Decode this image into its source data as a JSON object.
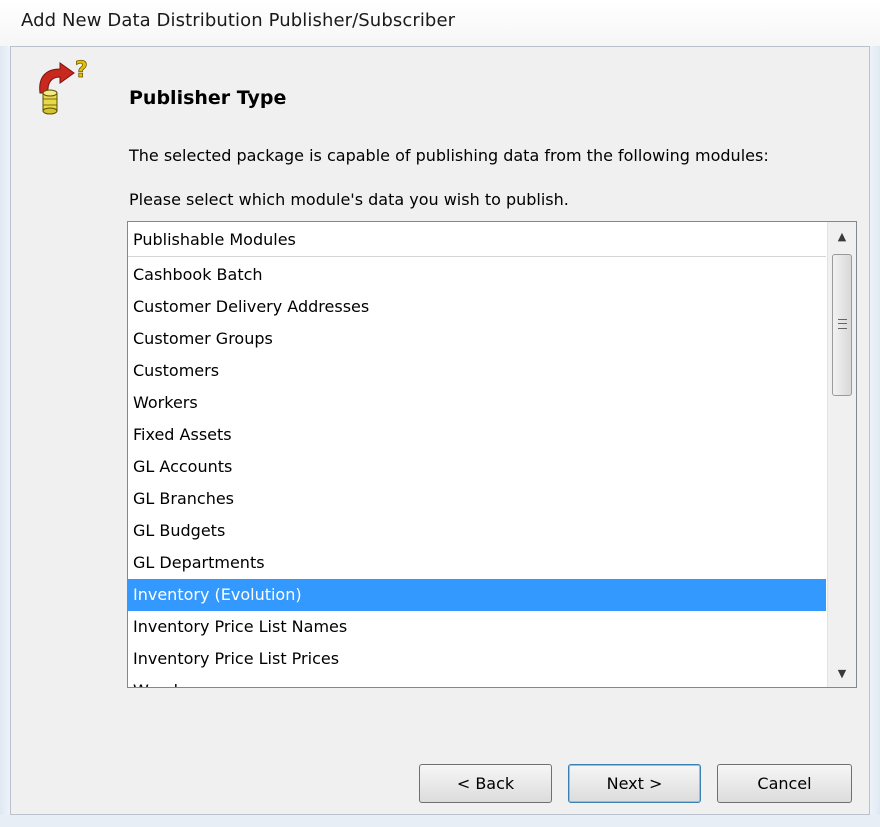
{
  "window": {
    "title": "Add New Data Distribution Publisher/Subscriber"
  },
  "page": {
    "heading": "Publisher Type",
    "description": "The selected package is capable of publishing data from the following modules:",
    "instruction": "Please select which module's data you wish to publish."
  },
  "list": {
    "column_header": "Publishable Modules",
    "selected_item": "Inventory (Evolution)",
    "items": [
      "Cashbook Batch",
      "Customer Delivery Addresses",
      "Customer Groups",
      "Customers",
      "Workers",
      "Fixed Assets",
      "GL Accounts",
      "GL Branches",
      "GL Budgets",
      "GL Departments",
      "Inventory (Evolution)",
      "Inventory Price List Names",
      "Inventory Price List Prices",
      "Warehouses"
    ]
  },
  "buttons": {
    "back": "< Back",
    "next": "Next >",
    "cancel": "Cancel"
  },
  "colors": {
    "selection": "#3399ff",
    "dialog_background": "#f0f0f0"
  },
  "icons": {
    "wizard": "database-arrow-question-icon",
    "scroll_up": "chevron-up-icon",
    "scroll_down": "chevron-down-icon"
  }
}
